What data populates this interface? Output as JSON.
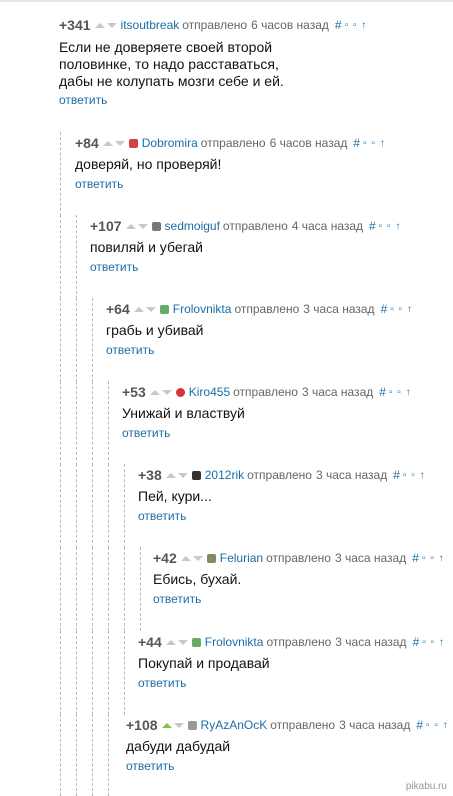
{
  "labels": {
    "sent": "отправлено",
    "reply": "ответить",
    "hash": "#",
    "tools": "▫ ▫ ↑"
  },
  "colors": {
    "link": "#1a6ea8",
    "score": "#555555",
    "upvote_active": "#7fc34b"
  },
  "comments": [
    {
      "score": "+341",
      "author": "itsoutbreak",
      "time": "6 часов назад",
      "avatar": "none",
      "text": "Если не доверяете своей второй\nполовинке, то надо расставаться,\nдабы не колупать мозги себе и ей."
    },
    {
      "score": "+84",
      "author": "Dobromira",
      "time": "6 часов назад",
      "avatar": "#c44",
      "text": "доверяй, но проверяй!"
    },
    {
      "score": "+107",
      "author": "sedmoiguf",
      "time": "4 часа назад",
      "avatar": "#777",
      "text": "повиляй и убегай"
    },
    {
      "score": "+64",
      "author": "Frolovnikta",
      "time": "3 часа назад",
      "avatar": "#6a6",
      "text": "грабь и убивай"
    },
    {
      "score": "+53",
      "author": "Kiro455",
      "time": "3 часа назад",
      "avatar": "#d33",
      "text": "Унижай и властвуй"
    },
    {
      "score": "+38",
      "author": "2012rik",
      "time": "3 часа назад",
      "avatar": "#333",
      "text": "Пей, кури..."
    },
    {
      "score": "+42",
      "author": "Felurian",
      "time": "3 часа назад",
      "avatar": "#886",
      "text": "Ебись, бухай."
    },
    {
      "score": "+44",
      "author": "Frolovnikta",
      "time": "3 часа назад",
      "avatar": "#6a6",
      "text": "Покупай и продавай"
    },
    {
      "score": "+108",
      "author": "RyAzAnOcK",
      "time": "3 часа назад",
      "avatar": "#999",
      "text": "дабуди дабудай",
      "upvoted": true
    }
  ],
  "watermark": "pikabu.ru"
}
